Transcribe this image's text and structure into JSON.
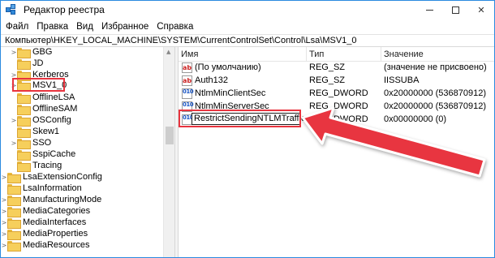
{
  "window": {
    "title": "Редактор реестра"
  },
  "menu": [
    "Файл",
    "Правка",
    "Вид",
    "Избранное",
    "Справка"
  ],
  "address": "Компьютер\\HKEY_LOCAL_MACHINE\\SYSTEM\\CurrentControlSet\\Control\\Lsa\\MSV1_0",
  "tree": [
    {
      "label": "GBG",
      "expand": true
    },
    {
      "label": "JD",
      "expand": false
    },
    {
      "label": "Kerberos",
      "expand": true
    },
    {
      "label": "MSV1_0",
      "expand": true,
      "selected": true
    },
    {
      "label": "OfflineLSA",
      "expand": false
    },
    {
      "label": "OfflineSAM",
      "expand": false
    },
    {
      "label": "OSConfig",
      "expand": true
    },
    {
      "label": "Skew1",
      "expand": false
    },
    {
      "label": "SSO",
      "expand": true
    },
    {
      "label": "SspiCache",
      "expand": false
    },
    {
      "label": "Tracing",
      "expand": false
    },
    {
      "label": "LsaExtensionConfig",
      "expand": true
    },
    {
      "label": "LsaInformation",
      "expand": false
    },
    {
      "label": "ManufacturingMode",
      "expand": true
    },
    {
      "label": "MediaCategories",
      "expand": true
    },
    {
      "label": "MediaInterfaces",
      "expand": true
    },
    {
      "label": "MediaProperties",
      "expand": true
    },
    {
      "label": "MediaResources",
      "expand": true
    }
  ],
  "columns": {
    "name": "Имя",
    "type": "Тип",
    "value": "Значение"
  },
  "values": [
    {
      "icon": "string-value-icon",
      "glyph": "ab",
      "name": "(По умолчанию)",
      "type": "REG_SZ",
      "data": "(значение не присвоено)"
    },
    {
      "icon": "string-value-icon",
      "glyph": "ab",
      "name": "Auth132",
      "type": "REG_SZ",
      "data": "IISSUBA"
    },
    {
      "icon": "dword-value-icon",
      "glyph": "010",
      "name": "NtlmMinClientSec",
      "type": "REG_DWORD",
      "data": "0x20000000 (536870912)"
    },
    {
      "icon": "dword-value-icon",
      "glyph": "010",
      "name": "NtlmMinServerSec",
      "type": "REG_DWORD",
      "data": "0x20000000 (536870912)"
    },
    {
      "icon": "dword-value-icon",
      "glyph": "010",
      "name": "RestrictSendingNTLMTraffic",
      "type": "REG_DWORD",
      "data": "0x00000000 (0)",
      "editing": true
    }
  ],
  "colors": {
    "highlight": "#e8343f",
    "frame": "#2b8ae0"
  }
}
